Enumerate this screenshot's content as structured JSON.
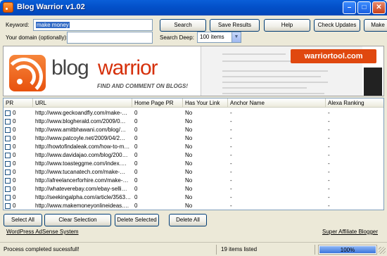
{
  "window": {
    "title": "Blog Warrior v1.02",
    "min": "–",
    "max": "□",
    "close": "✕"
  },
  "form": {
    "keyword_label": "Keyword:",
    "keyword_value": "make money",
    "domain_label": "Your domain (optionally):",
    "domain_value": "",
    "search_deep_label": "Search Deep:",
    "search_deep_value": "100 items"
  },
  "toolbar": {
    "search": "Search",
    "save_results": "Save Results",
    "help": "Help",
    "check_updates": "Check Updates",
    "make": "Make"
  },
  "banner": {
    "blog": "blog",
    "warrior": "warrior",
    "tagline": "FIND AND COMMENT ON BLOGS!",
    "site": "warriortool.com"
  },
  "table": {
    "columns": [
      "PR",
      "URL",
      "Home Page PR",
      "Has Your Link",
      "Anchor Name",
      "Alexa Ranking"
    ],
    "rows": [
      {
        "pr": "0",
        "url": "http://www.geckoandfly.com/make-…",
        "hp": "0",
        "link": "No",
        "anchor": "-",
        "alexa": "-"
      },
      {
        "pr": "0",
        "url": "http://www.blogherald.com/2009/0…",
        "hp": "0",
        "link": "No",
        "anchor": "-",
        "alexa": "-"
      },
      {
        "pr": "0",
        "url": "http://www.amitbhawani.com/blog/…",
        "hp": "0",
        "link": "No",
        "anchor": "-",
        "alexa": "-"
      },
      {
        "pr": "0",
        "url": "http://www.patcoyle.net/2009/04/2…",
        "hp": "0",
        "link": "No",
        "anchor": "-",
        "alexa": "-"
      },
      {
        "pr": "0",
        "url": "http://howtofindaleak.com/how-to-m…",
        "hp": "0",
        "link": "No",
        "anchor": "-",
        "alexa": "-"
      },
      {
        "pr": "0",
        "url": "http://www.davidajao.com/blog/200…",
        "hp": "0",
        "link": "No",
        "anchor": "-",
        "alexa": "-"
      },
      {
        "pr": "0",
        "url": "http://www.toasteggme.com/index.…",
        "hp": "0",
        "link": "No",
        "anchor": "-",
        "alexa": "-"
      },
      {
        "pr": "0",
        "url": "http://www.tucanatech.com/make-…",
        "hp": "0",
        "link": "No",
        "anchor": "-",
        "alexa": "-"
      },
      {
        "pr": "0",
        "url": "http://afreelancerforhire.com/make-…",
        "hp": "0",
        "link": "No",
        "anchor": "-",
        "alexa": "-"
      },
      {
        "pr": "0",
        "url": "http://whateverebay.com/ebay-selli…",
        "hp": "0",
        "link": "No",
        "anchor": "-",
        "alexa": "-"
      },
      {
        "pr": "0",
        "url": "http://seekingalpha.com/article/3563…",
        "hp": "0",
        "link": "No",
        "anchor": "-",
        "alexa": "-"
      },
      {
        "pr": "0",
        "url": "http://www.makemoneyonlineideas.…",
        "hp": "0",
        "link": "No",
        "anchor": "-",
        "alexa": "-"
      }
    ]
  },
  "actions": {
    "select_all": "Select All",
    "clear_selection": "Clear Selection",
    "delete_selected": "Delete Selected",
    "delete_all": "Delete All"
  },
  "links": {
    "left": "WordPress AdSense System",
    "right": "Super Affiliate Blogger"
  },
  "status": {
    "message": "Process completed sucessfull!",
    "count": "19 items listed",
    "progress_label": "100%",
    "progress_fraction": 1.0
  }
}
